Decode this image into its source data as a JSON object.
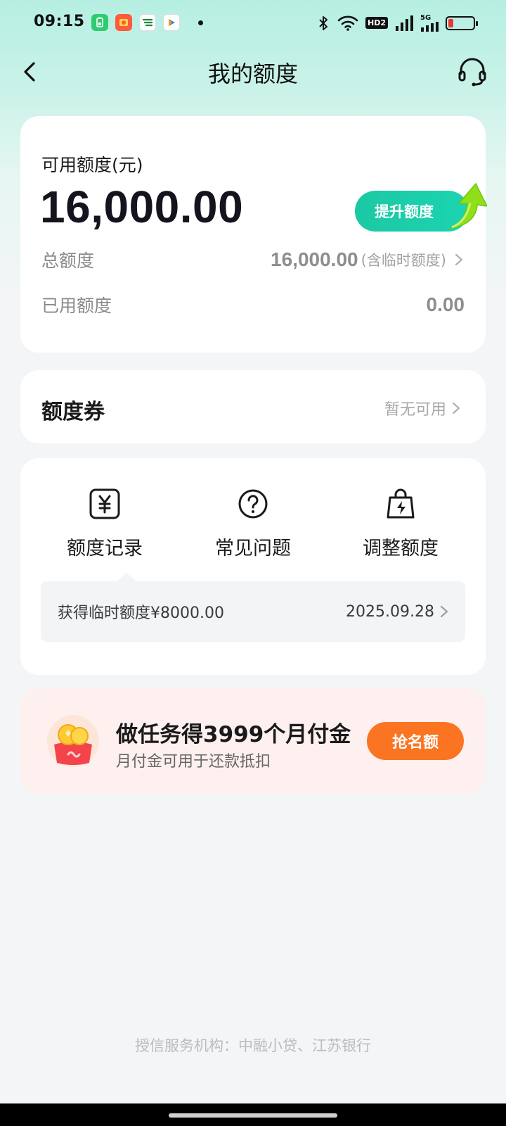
{
  "status_bar": {
    "time": "09:15",
    "network": "5G",
    "hd": "HD2",
    "battery_level": 0.2,
    "icons": [
      "bluetooth-icon",
      "wifi-icon",
      "signal-icon",
      "battery-icon"
    ]
  },
  "nav": {
    "title": "我的额度",
    "back_icon": "chevron-left-icon",
    "service_icon": "headset-icon"
  },
  "quota": {
    "available_label": "可用额度(元)",
    "available_amount": "16,000.00",
    "raise_button": "提升额度",
    "total_label": "总额度",
    "total_value": "16,000.00",
    "total_note": "(含临时额度)",
    "used_label": "已用额度",
    "used_value": "0.00"
  },
  "coupon": {
    "title": "额度券",
    "status": "暂无可用"
  },
  "menu": {
    "items": [
      {
        "label": "额度记录",
        "icon": "yen-receipt-icon"
      },
      {
        "label": "常见问题",
        "icon": "question-circle-icon"
      },
      {
        "label": "调整额度",
        "icon": "lightning-bag-icon"
      }
    ],
    "record": {
      "text": "获得临时额度¥8000.00",
      "date": "2025.09.28"
    }
  },
  "promo": {
    "title": "做任务得3999个月付金",
    "subtitle": "月付金可用于还款抵扣",
    "button": "抢名额",
    "icon": "gold-coin-icon"
  },
  "footer": {
    "text": "授信服务机构：中融小贷、江苏银行"
  },
  "colors": {
    "accent": "#1cc8a4",
    "promo_button": "#fb7422",
    "promo_bg": "#fdf0ef",
    "header_gradient": "#b6efe2"
  }
}
